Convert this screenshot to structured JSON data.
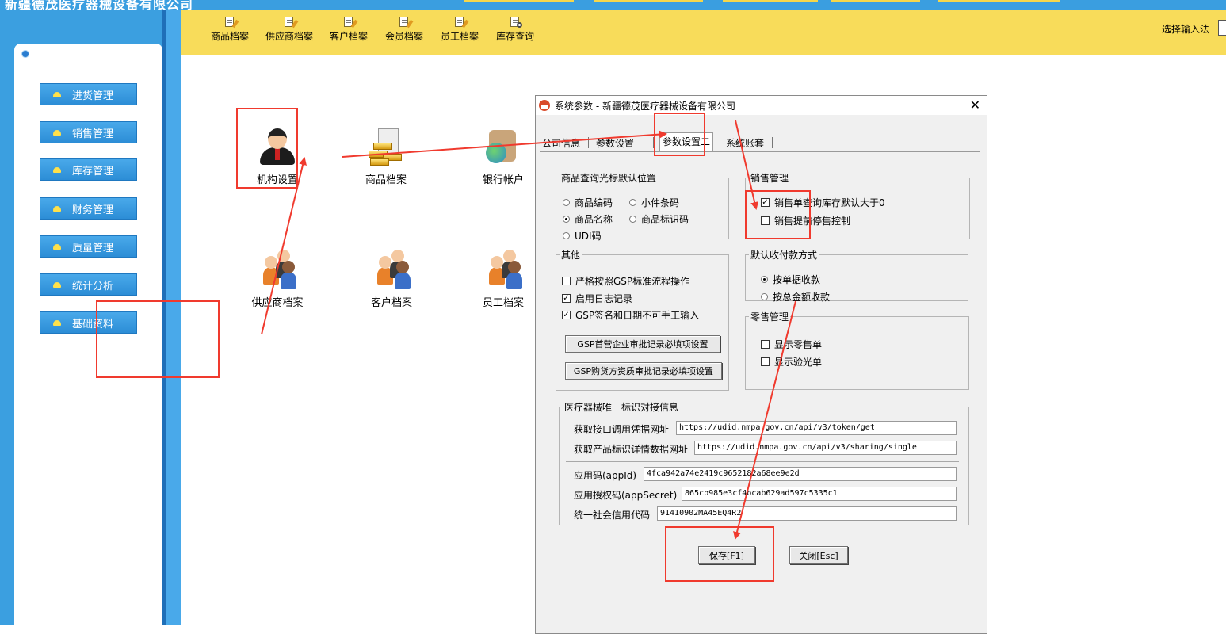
{
  "window": {
    "title_fragment": "新疆德茂医疗器械设备有限公司"
  },
  "sidebar": {
    "items": [
      {
        "label": "进货管理"
      },
      {
        "label": "销售管理"
      },
      {
        "label": "库存管理"
      },
      {
        "label": "财务管理"
      },
      {
        "label": "质量管理"
      },
      {
        "label": "统计分析"
      },
      {
        "label": "基础资料"
      }
    ]
  },
  "toolbar": {
    "items": [
      {
        "label": "商品档案",
        "icon": "doc-edit-icon"
      },
      {
        "label": "供应商档案",
        "icon": "doc-edit-icon"
      },
      {
        "label": "客户档案",
        "icon": "doc-edit-icon"
      },
      {
        "label": "会员档案",
        "icon": "doc-edit-icon"
      },
      {
        "label": "员工档案",
        "icon": "doc-edit-icon"
      },
      {
        "label": "库存查询",
        "icon": "doc-search-icon"
      }
    ],
    "input_method_label": "选择输入法"
  },
  "desktop": {
    "icons": [
      {
        "label": "机构设置",
        "icon": "person-icon"
      },
      {
        "label": "商品档案",
        "icon": "gold-bars-icon"
      },
      {
        "label": "银行帐户",
        "icon": "bank-icon"
      },
      {
        "label": "供应商档案",
        "icon": "group-icon"
      },
      {
        "label": "客户档案",
        "icon": "group-icon"
      },
      {
        "label": "员工档案",
        "icon": "group-icon"
      }
    ]
  },
  "dialog": {
    "title": "系统参数 - 新疆德茂医疗器械设备有限公司",
    "close": "✕",
    "tabs": [
      {
        "label": "公司信息"
      },
      {
        "label": "参数设置一"
      },
      {
        "label": "参数设置二",
        "active": true
      },
      {
        "label": "系统账套"
      }
    ],
    "cursor_group": {
      "legend": "商品查询光标默认位置",
      "options": [
        {
          "label": "商品编码",
          "checked": false
        },
        {
          "label": "小件条码",
          "checked": false
        },
        {
          "label": "商品名称",
          "checked": true
        },
        {
          "label": "商品标识码",
          "checked": false
        },
        {
          "label": "UDI码",
          "checked": false
        }
      ]
    },
    "sales_group": {
      "legend": "销售管理",
      "options": [
        {
          "label": "销售单查询库存默认大于0",
          "checked": true
        },
        {
          "label": "销售提前停售控制",
          "checked": false
        }
      ]
    },
    "other_group": {
      "legend": "其他",
      "options": [
        {
          "label": "严格按照GSP标准流程操作",
          "checked": false
        },
        {
          "label": "启用日志记录",
          "checked": true
        },
        {
          "label": "GSP签名和日期不可手工输入",
          "checked": true
        }
      ],
      "buttons": [
        {
          "label": "GSP首营企业审批记录必填项设置"
        },
        {
          "label": "GSP购货方资质审批记录必填项设置"
        }
      ]
    },
    "payment_group": {
      "legend": "默认收付款方式",
      "options": [
        {
          "label": "按单据收款",
          "checked": true
        },
        {
          "label": "按总金额收款",
          "checked": false
        }
      ]
    },
    "retail_group": {
      "legend": "零售管理",
      "options": [
        {
          "label": "显示零售单",
          "checked": false
        },
        {
          "label": "显示验光单",
          "checked": false
        }
      ]
    },
    "udi_group": {
      "legend": "医疗器械唯一标识对接信息",
      "fields": [
        {
          "label": "获取接口调用凭据网址",
          "value": "https://udid.nmpa.gov.cn/api/v3/token/get"
        },
        {
          "label": "获取产品标识详情数据网址",
          "value": "https://udid.nmpa.gov.cn/api/v3/sharing/single"
        },
        {
          "label": "应用码(appId)",
          "value": "4fca942a74e2419c9652182a68ee9e2d"
        },
        {
          "label": "应用授权码(appSecret)",
          "value": "865cb985e3cf4bcab629ad597c5335c1"
        },
        {
          "label": "统一社会信用代码",
          "value": "91410902MA45EQ4R2"
        }
      ]
    },
    "save_button": "保存[F1]",
    "close_button": "关闭[Esc]"
  }
}
